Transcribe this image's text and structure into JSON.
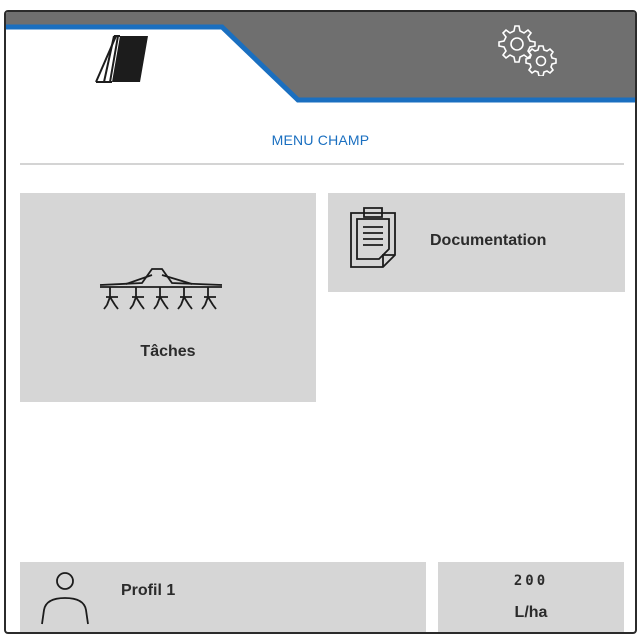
{
  "tabs": [
    {
      "name": "field",
      "icon": "field-icon",
      "active": true
    },
    {
      "name": "settings",
      "icon": "gears-icon",
      "active": false
    }
  ],
  "menu_title": "MENU CHAMP",
  "tiles": {
    "taches": {
      "label": "Tâches",
      "icon": "sprayer-boom-icon"
    },
    "documentation": {
      "label": "Documentation",
      "icon": "clipboard-icon"
    }
  },
  "footer": {
    "profile": {
      "label": "Profil 1",
      "icon": "user-icon"
    },
    "rate": {
      "value": "200",
      "unit": "L/ha"
    }
  },
  "colors": {
    "accent": "#1a6fc0",
    "tab_inactive": "#6f6f6f",
    "tile": "#d6d6d6",
    "text": "#2b2b2b"
  }
}
